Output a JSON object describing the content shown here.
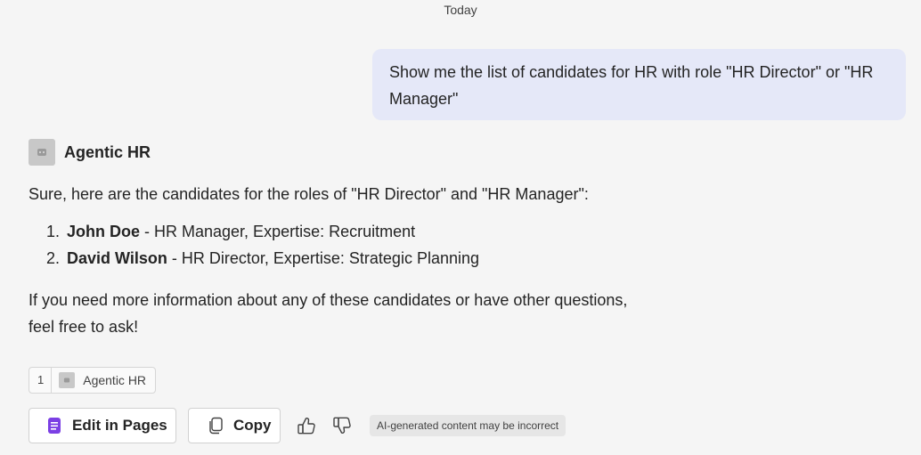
{
  "chat": {
    "date_separator": "Today",
    "user_message": "Show me the list of candidates for HR with role \"HR Director\" or \"HR Manager\""
  },
  "bot": {
    "name": "Agentic HR",
    "avatar_icon": "agent-avatar-icon",
    "intro": "Sure, here are the candidates for the roles of \"HR Director\" and \"HR Manager\":",
    "candidates": [
      {
        "number": "1.",
        "name": "John Doe",
        "details": " - HR Manager, Expertise: Recruitment"
      },
      {
        "number": "2.",
        "name": "David Wilson",
        "details": " - HR Director, Expertise: Strategic Planning"
      }
    ],
    "outro": "If you need more information about any of these candidates or have other questions, feel free to ask!"
  },
  "citation": {
    "number": "1",
    "label": "Agentic HR"
  },
  "actions": {
    "edit_in_pages_label": "Edit in Pages",
    "copy_label": "Copy",
    "thumbs_up_icon": "thumbs-up-icon",
    "thumbs_down_icon": "thumbs-down-icon",
    "ai_disclaimer": "AI-generated content may be incorrect"
  },
  "colors": {
    "background": "#f5f5f5",
    "user_bubble": "#e5e8f8",
    "pages_icon": "#7b3fe4"
  }
}
